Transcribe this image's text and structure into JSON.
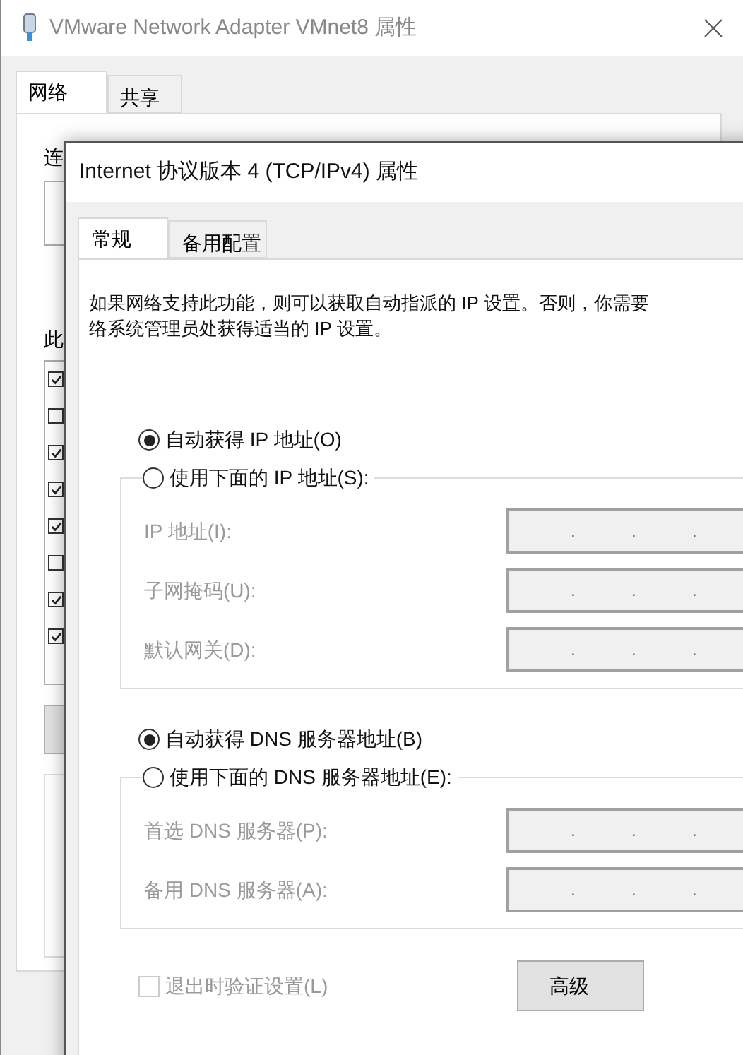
{
  "back_window": {
    "title": "VMware Network Adapter VMnet8 属性",
    "tabs": [
      {
        "label": "网络",
        "selected": true
      },
      {
        "label": "共享",
        "selected": false
      }
    ],
    "connect_label": "连",
    "components_label": "此",
    "components": [
      {
        "checked": true
      },
      {
        "checked": false
      },
      {
        "checked": true
      },
      {
        "checked": true
      },
      {
        "checked": true
      },
      {
        "checked": false
      },
      {
        "checked": true
      },
      {
        "checked": true
      }
    ]
  },
  "dialog": {
    "title": "Internet 协议版本 4 (TCP/IPv4) 属性",
    "tabs": [
      {
        "label": "常规",
        "selected": true
      },
      {
        "label": "备用配置",
        "selected": false
      }
    ],
    "description_lines": [
      "如果网络支持此功能，则可以获取自动指派的 IP 设置。否则，你需要",
      "络系统管理员处获得适当的 IP 设置。"
    ],
    "ip_auto": {
      "label": "自动获得 IP 地址(O)",
      "selected": true
    },
    "ip_manual": {
      "label": "使用下面的 IP 地址(S):",
      "selected": false,
      "fields": [
        {
          "label": "IP 地址(I):",
          "disabled": true,
          "separators": [
            ".",
            ".",
            "."
          ]
        },
        {
          "label": "子网掩码(U):",
          "disabled": true,
          "separators": [
            ".",
            ".",
            "."
          ]
        },
        {
          "label": "默认网关(D):",
          "disabled": true,
          "separators": [
            ".",
            ".",
            "."
          ]
        }
      ]
    },
    "dns_auto": {
      "label": "自动获得 DNS 服务器地址(B)",
      "selected": true
    },
    "dns_manual": {
      "label": "使用下面的 DNS 服务器地址(E):",
      "selected": false,
      "fields": [
        {
          "label": "首选 DNS 服务器(P):",
          "disabled": true,
          "separators": [
            ".",
            ".",
            "."
          ]
        },
        {
          "label": "备用 DNS 服务器(A):",
          "disabled": true,
          "separators": [
            ".",
            ".",
            "."
          ]
        }
      ]
    },
    "validate": {
      "label": "退出时验证设置(L)",
      "checked": false,
      "disabled": true
    },
    "advanced_button": "高级"
  }
}
